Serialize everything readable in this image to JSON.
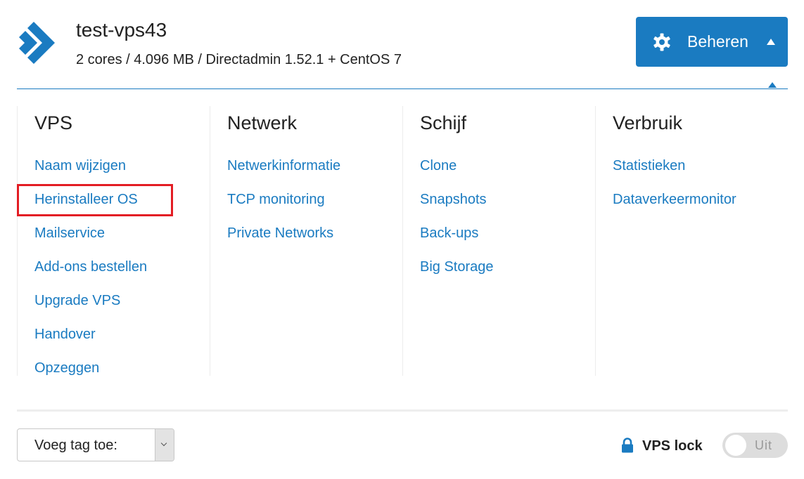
{
  "header": {
    "title": "test-vps43",
    "subtitle": "2 cores / 4.096 MB / Directadmin 1.52.1 + CentOS 7",
    "logo_icon": "double-chevron-right-logo",
    "accent_color": "#1a7bc1"
  },
  "manage_button": {
    "label": "Beheren",
    "icon": "gear-icon",
    "caret": "caret-up-icon",
    "expanded": true
  },
  "menu": {
    "columns": [
      {
        "heading": "VPS",
        "items": [
          {
            "label": "Naam wijzigen"
          },
          {
            "label": "Herinstalleer OS",
            "highlighted": true
          },
          {
            "label": "Mailservice"
          },
          {
            "label": "Add-ons bestellen"
          },
          {
            "label": "Upgrade VPS"
          },
          {
            "label": "Handover"
          },
          {
            "label": "Opzeggen"
          }
        ]
      },
      {
        "heading": "Netwerk",
        "items": [
          {
            "label": "Netwerkinformatie"
          },
          {
            "label": "TCP monitoring"
          },
          {
            "label": "Private Networks"
          }
        ]
      },
      {
        "heading": "Schijf",
        "items": [
          {
            "label": "Clone"
          },
          {
            "label": "Snapshots"
          },
          {
            "label": "Back-ups"
          },
          {
            "label": "Big Storage"
          }
        ]
      },
      {
        "heading": "Verbruik",
        "items": [
          {
            "label": "Statistieken"
          },
          {
            "label": "Dataverkeermonitor"
          }
        ]
      }
    ],
    "highlight_color": "#e31d24"
  },
  "footer": {
    "tag_select": {
      "value": "Voeg tag toe:"
    },
    "vps_lock": {
      "label": "VPS lock",
      "icon": "lock-icon",
      "toggle_state": "Uit",
      "enabled": false
    }
  }
}
